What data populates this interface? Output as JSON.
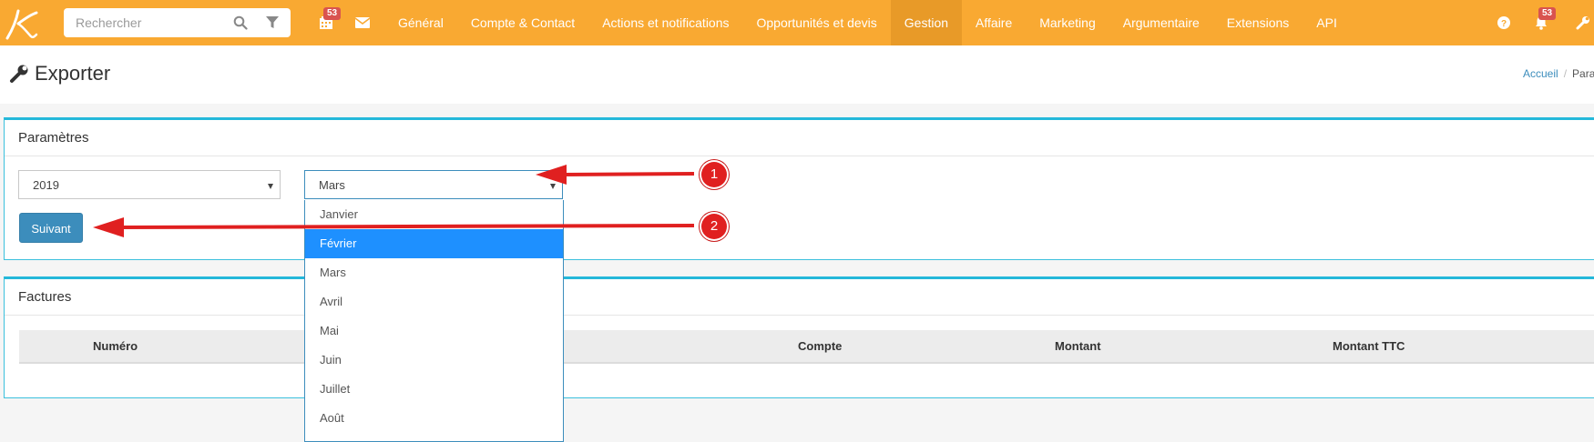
{
  "colors": {
    "navbar": "#f9a932",
    "navbar_active": "#e89a28",
    "box_accent": "#24b8da",
    "primary_button": "#3c8dbc",
    "badge": "#d9534f",
    "dropdown_highlight": "#1e90ff",
    "annotation": "#e02020"
  },
  "navbar": {
    "logo_icon": "k-logo-icon",
    "search": {
      "placeholder": "Rechercher",
      "value": ""
    },
    "calendar_badge": "53",
    "notifications_badge": "53",
    "menu": [
      {
        "label": "Général",
        "active": false
      },
      {
        "label": "Compte & Contact",
        "active": false
      },
      {
        "label": "Actions et notifications",
        "active": false
      },
      {
        "label": "Opportunités et devis",
        "active": false
      },
      {
        "label": "Gestion",
        "active": true
      },
      {
        "label": "Affaire",
        "active": false
      },
      {
        "label": "Marketing",
        "active": false
      },
      {
        "label": "Argumentaire",
        "active": false
      },
      {
        "label": "Extensions",
        "active": false
      },
      {
        "label": "API",
        "active": false
      }
    ]
  },
  "page": {
    "title": "Exporter",
    "breadcrumb": {
      "home": "Accueil",
      "separator": "/",
      "current": "Para"
    }
  },
  "parametres": {
    "title": "Paramètres",
    "year_select": "2019",
    "month_select": "Mars",
    "next_button": "Suivant"
  },
  "month_dropdown": {
    "highlighted": "Février",
    "options": [
      "Janvier",
      "Février",
      "Mars",
      "Avril",
      "Mai",
      "Juin",
      "Juillet",
      "Août"
    ]
  },
  "factures": {
    "title": "Factures",
    "columns": [
      "Numéro",
      "Compte",
      "Montant",
      "Montant TTC"
    ]
  },
  "annotations": [
    {
      "number": "1",
      "target": "month-select"
    },
    {
      "number": "2",
      "target": "suivant-button"
    }
  ]
}
